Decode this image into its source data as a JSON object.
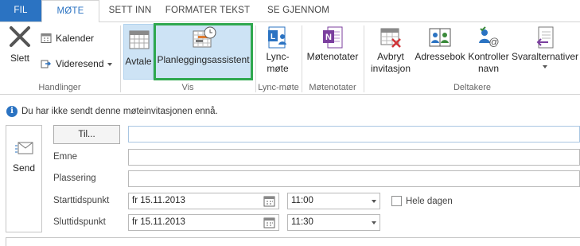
{
  "tabs": {
    "fil": "FIL",
    "mote": "MØTE",
    "sett_inn": "SETT INN",
    "formater_tekst": "FORMATER TEKST",
    "se_gjennom": "SE GJENNOM"
  },
  "ribbon": {
    "handlinger": {
      "label": "Handlinger",
      "slett": "Slett",
      "kalender": "Kalender",
      "videresend": "Videresend"
    },
    "vis": {
      "label": "Vis",
      "avtale": "Avtale",
      "planlegging": "Planleggingsassistent"
    },
    "lync": {
      "label": "Lync-møte",
      "btn_line1": "Lync-",
      "btn_line2": "møte"
    },
    "motenotater": {
      "label": "Møtenotater",
      "btn": "Møtenotater"
    },
    "deltakere": {
      "label": "Deltakere",
      "avbryt_line1": "Avbryt",
      "avbryt_line2": "invitasjon",
      "adressebok": "Adressebok",
      "kontroller_line1": "Kontroller",
      "kontroller_line2": "navn",
      "svaralternativer": "Svaralternativer"
    }
  },
  "info": {
    "message": "Du har ikke sendt denne møteinvitasjonen ennå."
  },
  "form": {
    "send": "Send",
    "til": "Til...",
    "to_value": "",
    "emne_label": "Emne",
    "subject_value": "",
    "plassering_label": "Plassering",
    "location_value": "",
    "start_label": "Starttidspunkt",
    "start_date": "fr 15.11.2013",
    "start_time": "11:00",
    "end_label": "Sluttidspunkt",
    "end_date": "fr 15.11.2013",
    "end_time": "11:30",
    "all_day_label": "Hele dagen",
    "all_day_checked": false
  },
  "colors": {
    "accent": "#2b73c2",
    "selected_bg": "#cde3f5",
    "highlight_box": "#2fa84f"
  }
}
